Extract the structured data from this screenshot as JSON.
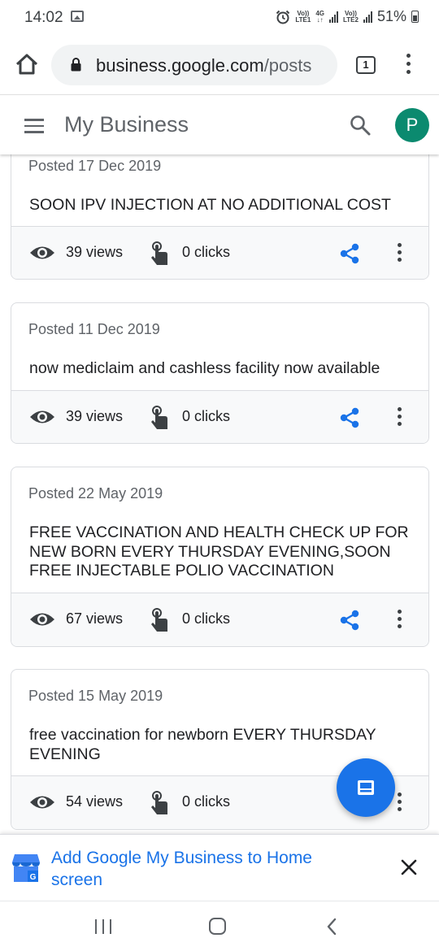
{
  "status_bar": {
    "time": "14:02",
    "lte1_top": "Vo))",
    "lte1_bottom": "LTE1",
    "net_top": "4G",
    "net_bottom": "↓↑",
    "lte2_top": "Vo))",
    "lte2_bottom": "LTE2",
    "battery": "51%"
  },
  "browser": {
    "url_domain": "business.google.com",
    "url_path": "/posts",
    "tab_count": "1"
  },
  "app_bar": {
    "title": "My Business",
    "avatar_letter": "P",
    "avatar_color": "#0b8a6f"
  },
  "posts": [
    {
      "date": "Posted 17 Dec 2019",
      "text": "SOON IPV INJECTION AT NO ADDITIONAL COST",
      "views": "39 views",
      "clicks": "0 clicks"
    },
    {
      "date": "Posted 11 Dec 2019",
      "text": "now mediclaim and cashless facility now available",
      "views": "39 views",
      "clicks": "0 clicks"
    },
    {
      "date": "Posted 22 May 2019",
      "text": "FREE VACCINATION AND HEALTH CHECK UP FOR NEW BORN EVERY THURSDAY EVENING,SOON FREE INJECTABLE POLIO VACCINATION",
      "views": "67 views",
      "clicks": "0 clicks"
    },
    {
      "date": "Posted 15 May 2019",
      "text": "free vaccination for newborn EVERY THURSDAY EVENING",
      "views": "54 views",
      "clicks": "0 clicks"
    }
  ],
  "install_banner": {
    "text": "Add Google My Business to Home screen"
  },
  "icons": {
    "home": "home-icon",
    "lock": "lock-icon",
    "menu": "more-vert-icon",
    "hamburger": "hamburger-icon",
    "search": "search-icon",
    "views": "eye-icon",
    "clicks": "touch-icon",
    "share": "share-icon",
    "fab": "create-post-icon",
    "close": "close-icon"
  },
  "colors": {
    "accent": "#1a73e8",
    "share": "#1a73e8",
    "text_secondary": "#5f6368"
  }
}
